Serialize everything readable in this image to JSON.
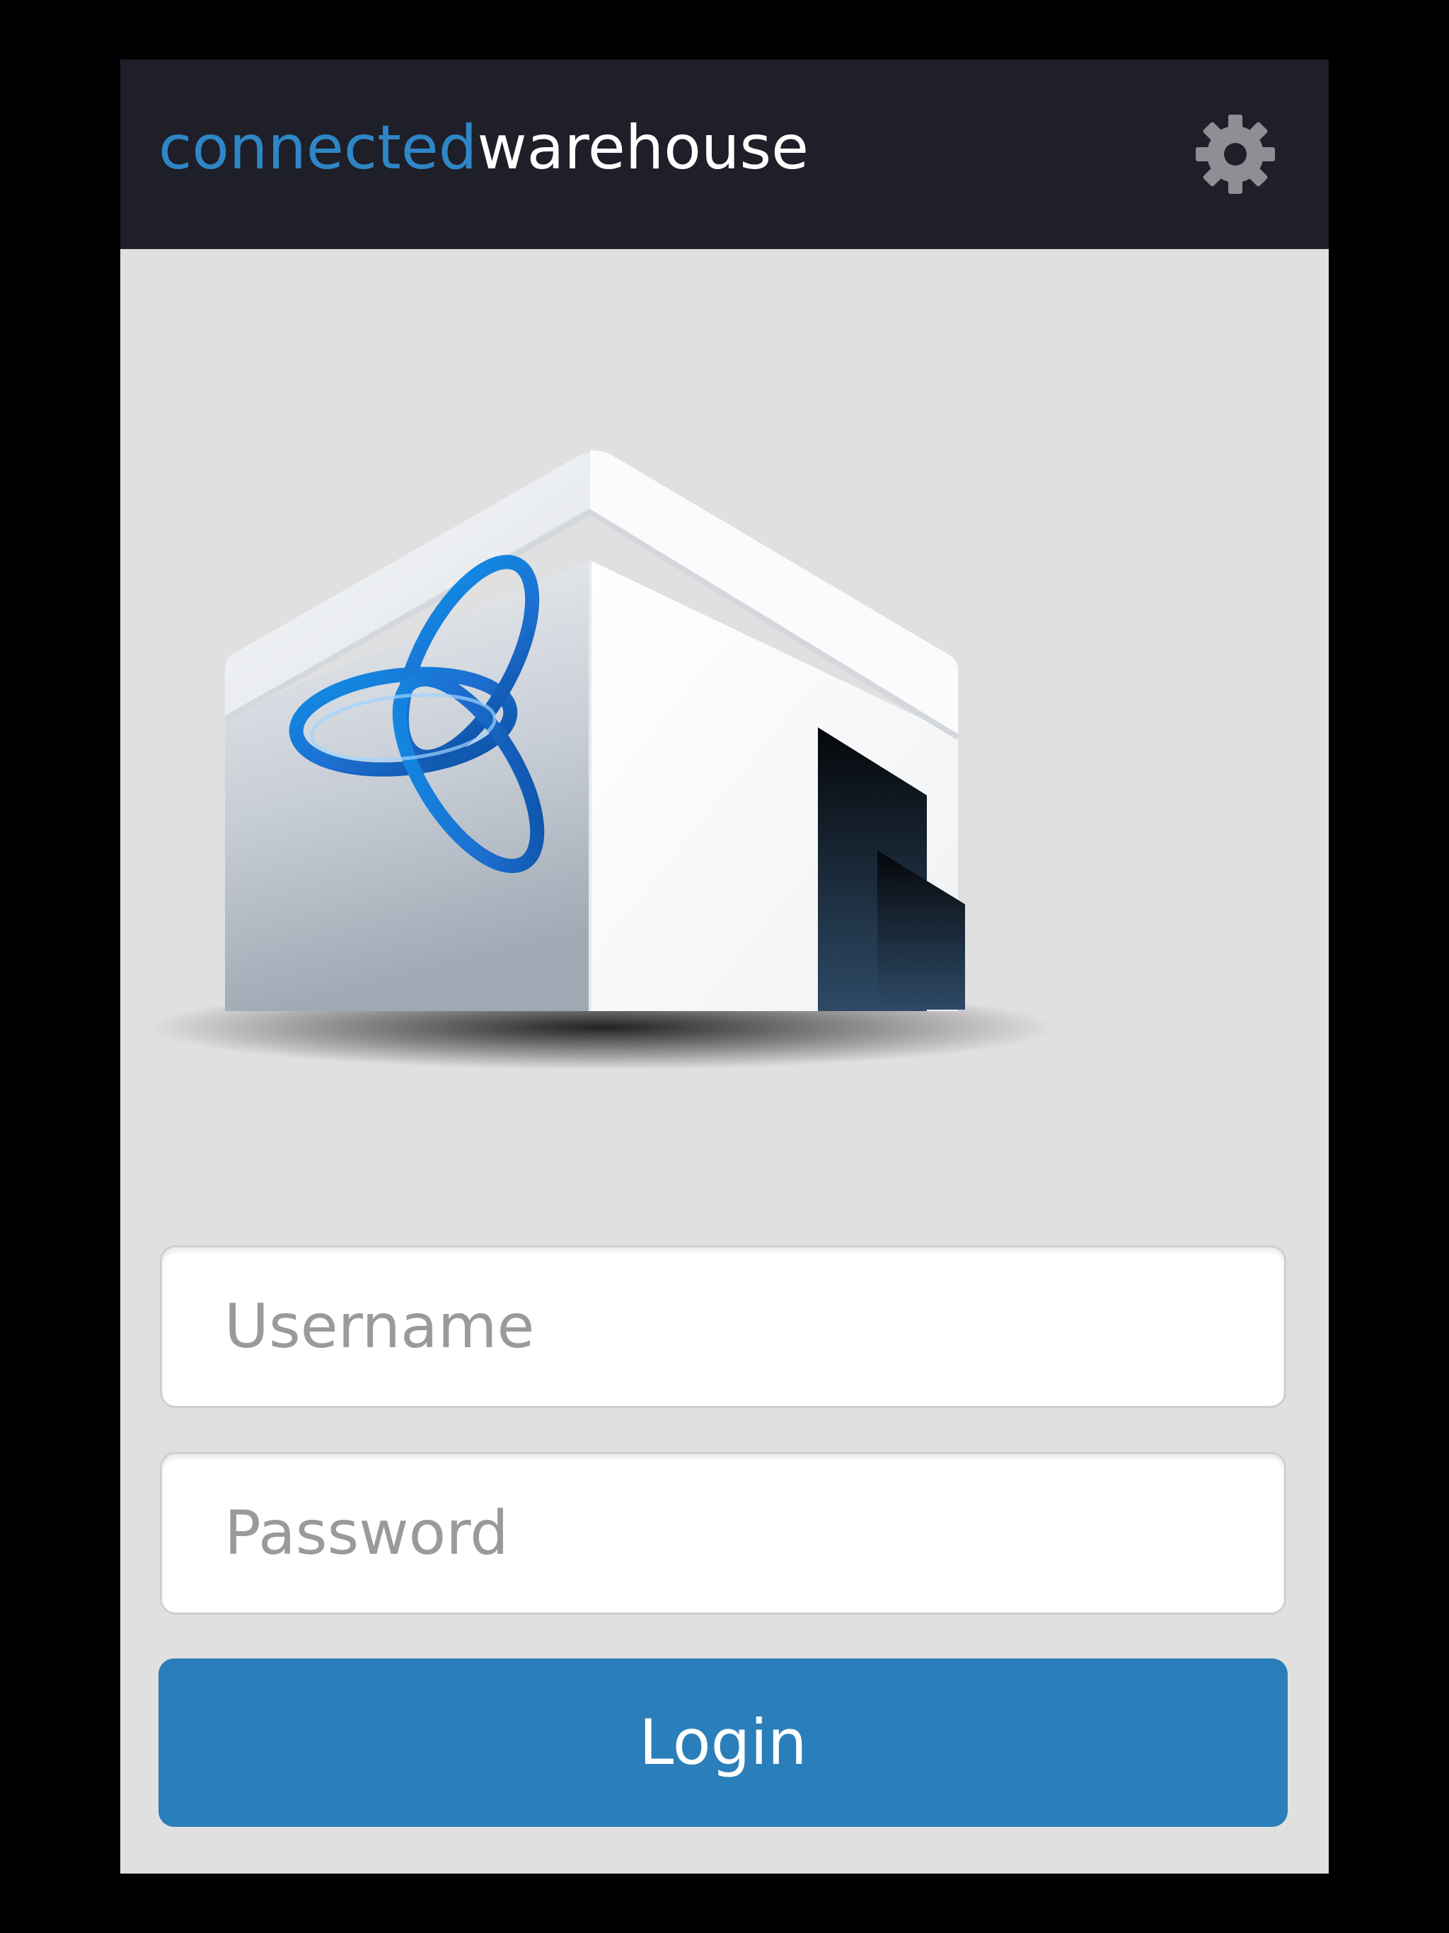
{
  "header": {
    "brand_part1": "connected",
    "brand_part2": "warehouse",
    "settings_icon": "gear-icon"
  },
  "hero": {
    "logo": "warehouse-building-logo"
  },
  "form": {
    "username_placeholder": "Username",
    "username_value": "",
    "password_placeholder": "Password",
    "password_value": "",
    "login_label": "Login"
  },
  "colors": {
    "header_bg": "#1e1f28",
    "brand_accent": "#2f86c6",
    "page_bg": "#e0e0e0",
    "button": "#2a7fba",
    "outer_bg": "#000000"
  }
}
